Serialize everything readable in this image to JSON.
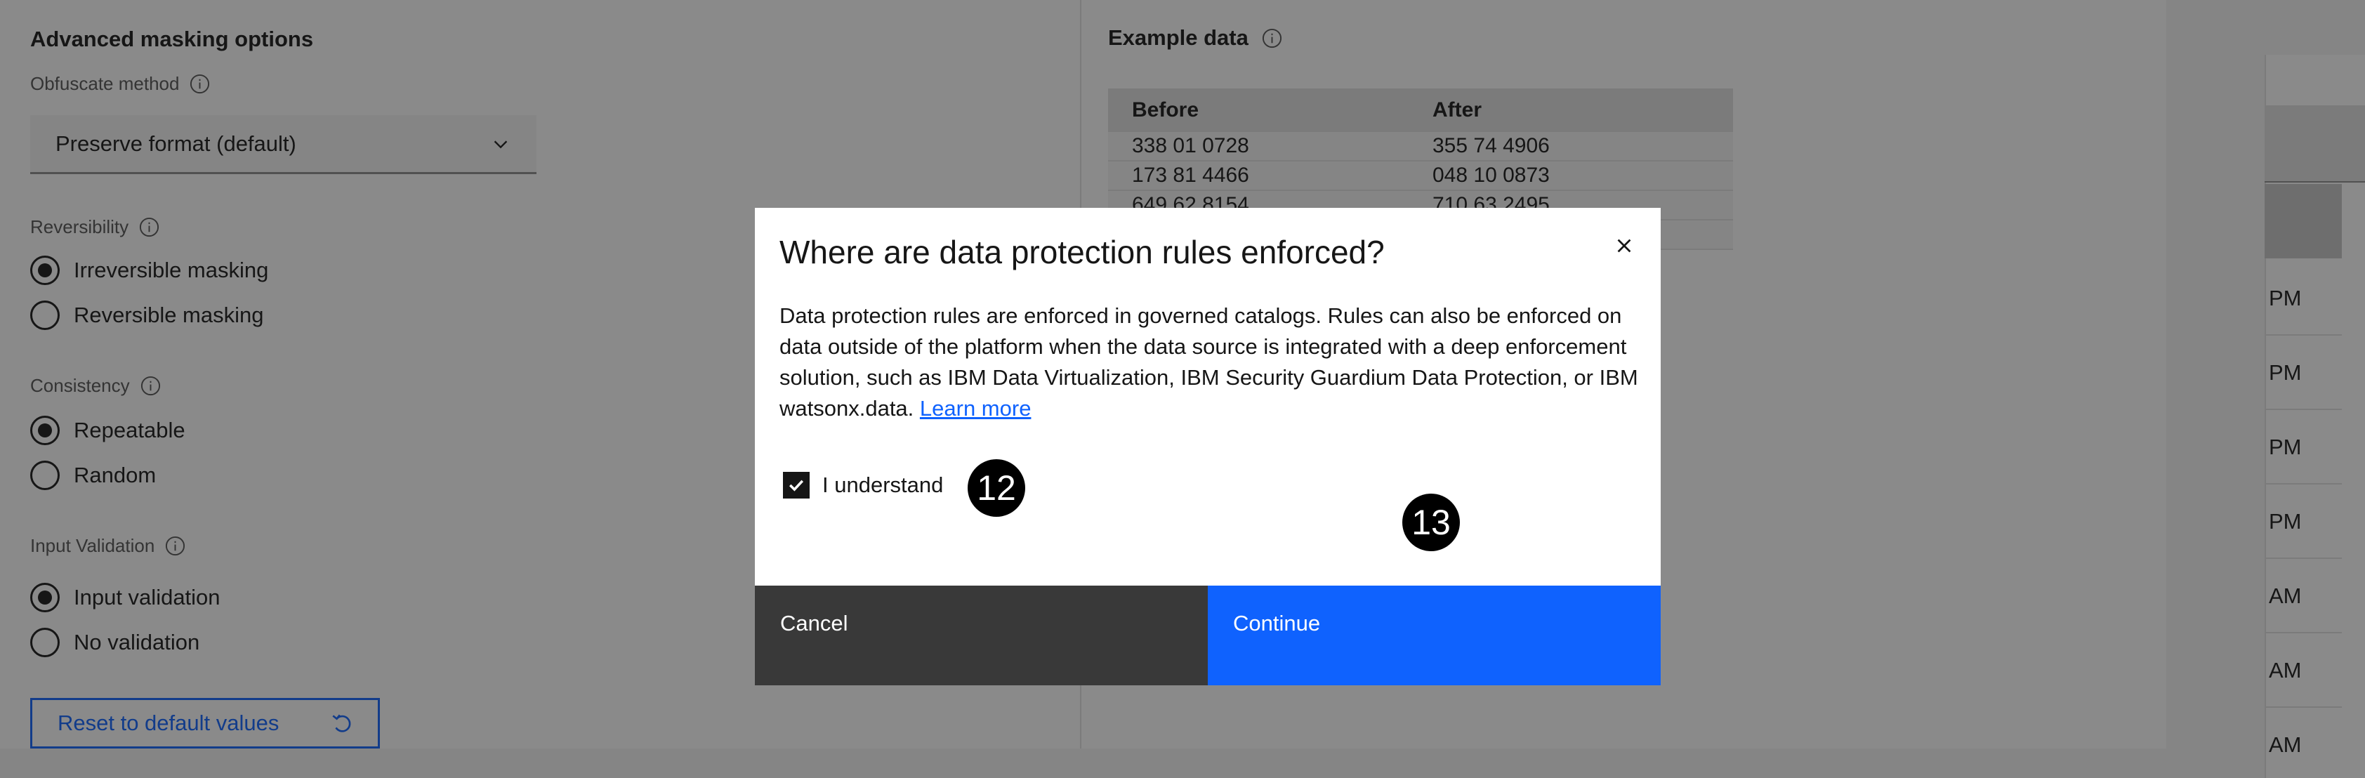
{
  "background": {
    "left": {
      "section_title": "Advanced masking options",
      "obfuscate_label": "Obfuscate method",
      "obfuscate_value": "Preserve format (default)",
      "reversibility_label": "Reversibility",
      "reversibility_options": [
        "Irreversible masking",
        "Reversible masking"
      ],
      "consistency_label": "Consistency",
      "consistency_options": [
        "Repeatable",
        "Random"
      ],
      "validation_label": "Input Validation",
      "validation_options": [
        "Input validation",
        "No validation"
      ],
      "reset_label": "Reset to default values"
    },
    "right": {
      "example_title": "Example data",
      "columns": [
        "Before",
        "After"
      ],
      "rows": [
        [
          "338 01 0728",
          "355 74 4906"
        ],
        [
          "173 81 4466",
          "048 10 0873"
        ],
        [
          "649 62 8154",
          "710 63 2495"
        ],
        [
          "",
          ""
        ]
      ]
    },
    "far_right": {
      "times": [
        "PM",
        "PM",
        "PM",
        "PM",
        "AM",
        "AM",
        "AM"
      ]
    }
  },
  "modal": {
    "title": "Where are data protection rules enforced?",
    "body": "Data protection rules are enforced in governed catalogs. Rules can also be enforced on data outside of the platform when the data source is integrated with a deep enforcement solution, such as IBM Data Virtualization, IBM Security Guardium Data Protection, or IBM watsonx.data.",
    "learn_more": "Learn more",
    "checkbox_label": "I understand",
    "cancel_label": "Cancel",
    "continue_label": "Continue"
  },
  "markers": [
    "12",
    "13"
  ],
  "colors": {
    "primary": "#0f62fe",
    "secondary_button": "#393939",
    "overlay": "rgba(22,22,22,0.5)"
  }
}
